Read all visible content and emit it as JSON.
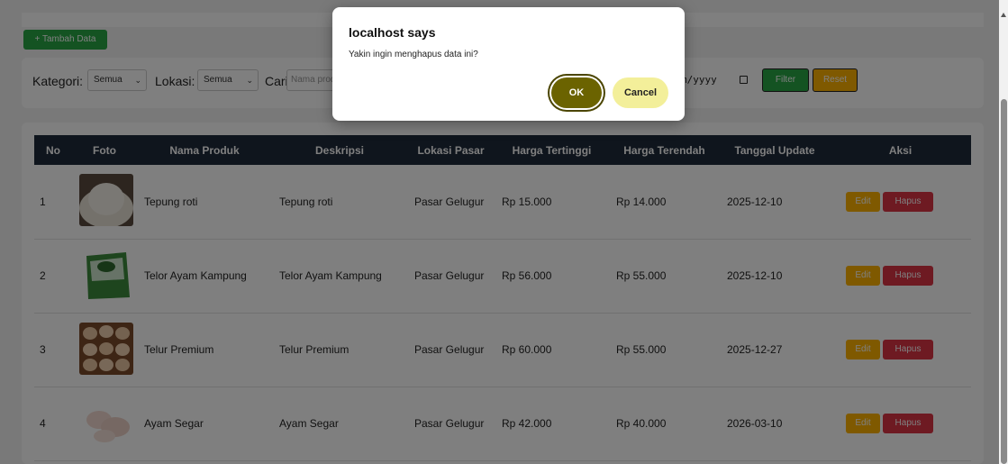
{
  "toolbar": {
    "add_label": "+ Tambah Data"
  },
  "filters": {
    "kategori_label": "Kategori:",
    "kategori_value": "Semua",
    "lokasi_label": "Lokasi:",
    "lokasi_value": "Semua",
    "cari_label": "Cari:",
    "cari_placeholder": "Nama produk",
    "date_value": "m/yyyy",
    "filter_label": "Filter",
    "reset_label": "Reset"
  },
  "table": {
    "headers": [
      "No",
      "Foto",
      "Nama Produk",
      "Deskripsi",
      "Lokasi Pasar",
      "Harga Tertinggi",
      "Harga Terendah",
      "Tanggal Update",
      "Aksi"
    ],
    "rows": [
      {
        "no": "1",
        "nama": "Tepung roti",
        "deskripsi": "Tepung roti",
        "lokasi": "Pasar Gelugur",
        "tertinggi": "Rp 15.000",
        "terendah": "Rp 14.000",
        "tanggal": "2025-12-10"
      },
      {
        "no": "2",
        "nama": "Telor Ayam Kampung",
        "deskripsi": "Telor Ayam Kampung",
        "lokasi": "Pasar Gelugur",
        "tertinggi": "Rp 56.000",
        "terendah": "Rp 55.000",
        "tanggal": "2025-12-10"
      },
      {
        "no": "3",
        "nama": "Telur Premium",
        "deskripsi": "Telur Premium",
        "lokasi": "Pasar Gelugur",
        "tertinggi": "Rp 60.000",
        "terendah": "Rp 55.000",
        "tanggal": "2025-12-27"
      },
      {
        "no": "4",
        "nama": "Ayam Segar",
        "deskripsi": "Ayam Segar",
        "lokasi": "Pasar Gelugur",
        "tertinggi": "Rp 42.000",
        "terendah": "Rp 40.000",
        "tanggal": "2026-03-10"
      }
    ],
    "edit_label": "Edit",
    "hapus_label": "Hapus"
  },
  "dialog": {
    "title": "localhost says",
    "message": "Yakin ingin menghapus data ini?",
    "ok_label": "OK",
    "cancel_label": "Cancel"
  },
  "colors": {
    "header_bg": "#1f2a3a",
    "add_green": "#28a745",
    "edit_amber": "#ffb300",
    "hapus_red": "#dc3545",
    "ok_olive": "#6b6300",
    "cancel_yellow": "#f3ef9a"
  }
}
